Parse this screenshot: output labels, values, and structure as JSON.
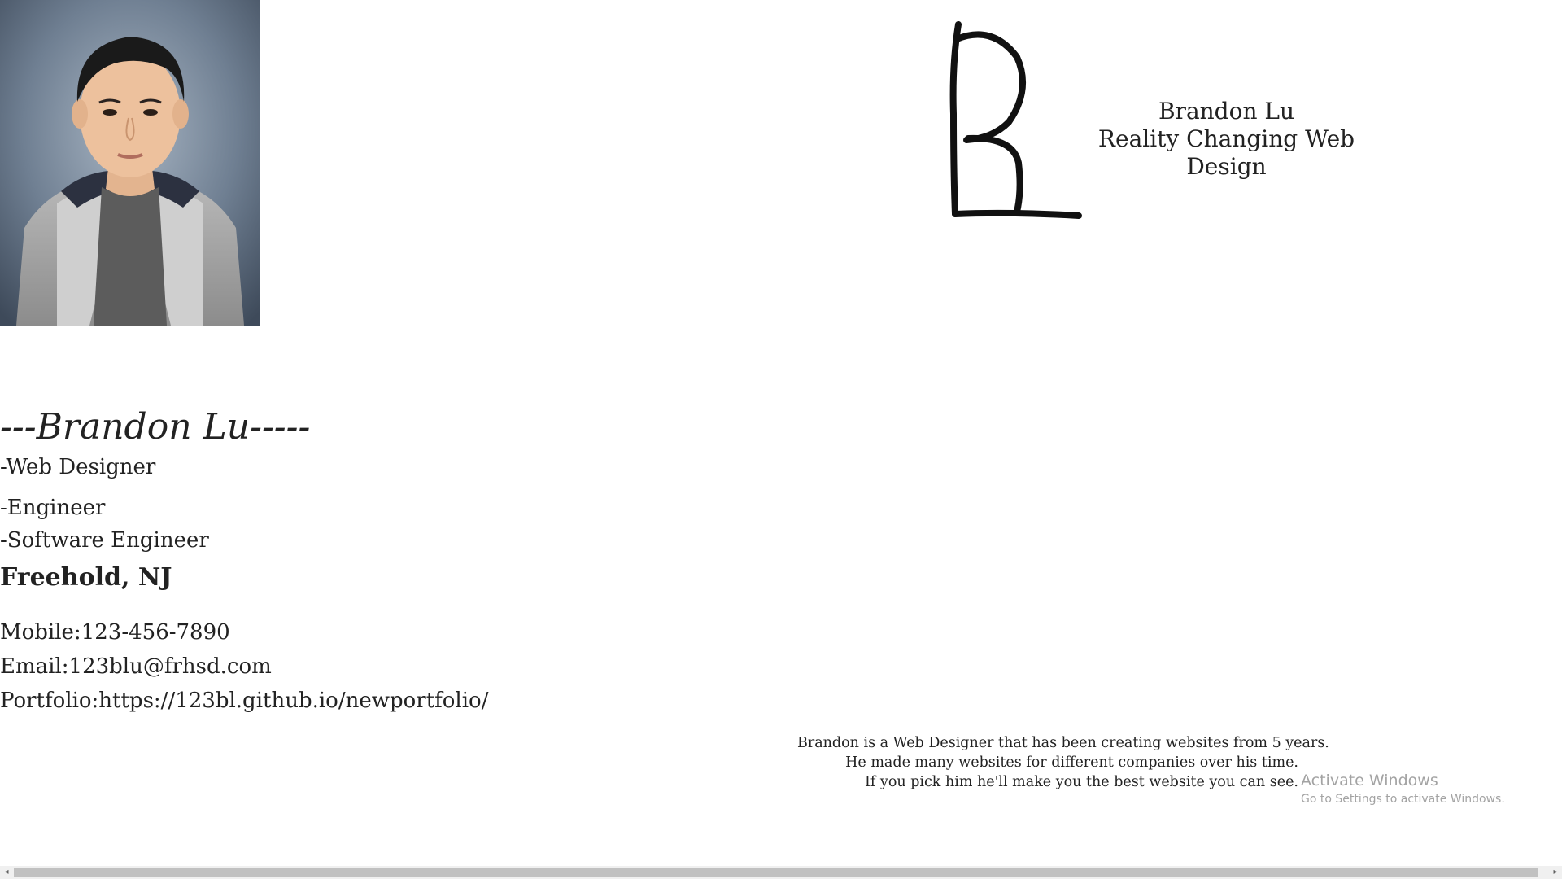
{
  "profile": {
    "photo_alt": "Portrait photo",
    "heading": "---Brandon Lu-----",
    "roles": [
      "-Web Designer",
      "-Engineer",
      "-Software Engineer"
    ],
    "location": "Freehold, NJ",
    "contact": {
      "mobile": "Mobile:123-456-7890",
      "email": "Email:123blu@frhsd.com",
      "portfolio": "Portfolio:https://123bl.github.io/newportfolio/"
    }
  },
  "brand": {
    "logo_letter": "B",
    "name": "Brandon Lu",
    "tagline": "Reality Changing Web Design"
  },
  "about": {
    "lines": [
      "Brandon is a Web Designer that has been creating websites from 5 years.",
      "He made many websites for different companies over his time.",
      "If you pick him he'll make you the best website you can see."
    ]
  },
  "watermark": {
    "title": "Activate Windows",
    "subtitle": "Go to Settings to activate Windows."
  },
  "scrollbar": {
    "left_arrow": "◂",
    "right_arrow": "▸"
  },
  "colors": {
    "text": "#222222",
    "watermark": "#a3a3a3",
    "scroll_track": "#f0f0f0",
    "scroll_thumb": "#c1c1c1"
  }
}
